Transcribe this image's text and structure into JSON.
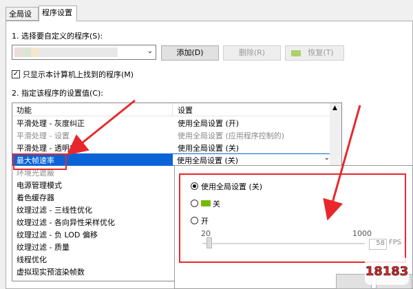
{
  "tabs": [
    {
      "label": "全局设置",
      "active": false
    },
    {
      "label": "程序设置",
      "active": true
    }
  ],
  "section1": {
    "label": "1. 选择要自定义的程序(S):",
    "program_value": "",
    "add_button": "添加(D)",
    "delete_button": "删除(R)",
    "restore_button": "恢复(T)"
  },
  "checkbox": {
    "label": "只显示本计算机上找到的程序(M)",
    "checked": true
  },
  "section2": {
    "label": "2. 指定该程序的设置值(C):"
  },
  "list": {
    "col_feature": "功能",
    "col_setting": "设置",
    "rows": [
      {
        "feature": "平滑处理 - 灰度纠正",
        "setting": "使用全局设置 (开)",
        "dim": false
      },
      {
        "feature": "平滑处理 - 设置",
        "setting": "使用全局设置 (应用程序控制的)",
        "dim": true
      },
      {
        "feature": "平滑处理 - 透明度",
        "setting": "使用全局设置 (关)",
        "dim": false
      },
      {
        "feature": "最大帧速率",
        "setting": "使用全局设置 (关)",
        "selected": true
      },
      {
        "feature": "环境光遮蔽",
        "setting": "",
        "dim": true
      },
      {
        "feature": "电源管理模式",
        "setting": ""
      },
      {
        "feature": "着色缓存器",
        "setting": ""
      },
      {
        "feature": "纹理过滤 - 三线性优化",
        "setting": ""
      },
      {
        "feature": "纹理过滤 - 各向异性采样优化",
        "setting": ""
      },
      {
        "feature": "纹理过滤 - 负 LOD 偏移",
        "setting": ""
      },
      {
        "feature": "纹理过滤 - 质量",
        "setting": ""
      },
      {
        "feature": "线程优化",
        "setting": ""
      },
      {
        "feature": "虚拟现实预渲染帧数",
        "setting": ""
      }
    ]
  },
  "popup": {
    "option_global": "使用全局设置 (关)",
    "option_off": "关",
    "option_on": "开",
    "slider_min": "20",
    "slider_max": "1000",
    "fps_value": "58",
    "fps_unit": "FPS",
    "selected_option": "option_global"
  },
  "watermark": {
    "text": "18183"
  },
  "colors": {
    "accent_selection": "#0a64d8",
    "annotation_red": "#e8272b",
    "nvidia_green": "#76b900"
  }
}
